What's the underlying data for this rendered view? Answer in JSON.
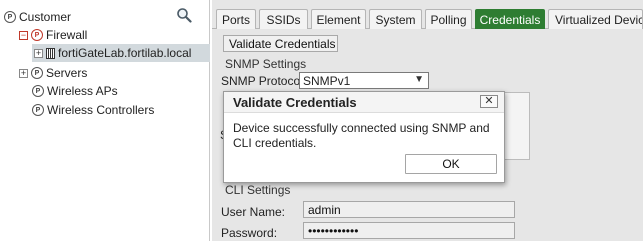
{
  "tree": {
    "search_icon": "search-icon",
    "items": [
      {
        "label": "Customer",
        "icon": "node-icon"
      },
      {
        "label": "Firewall",
        "icon": "node-icon",
        "expander": "minus"
      },
      {
        "label": "fortiGateLab.fortilab.local",
        "icon": "device-icon",
        "expander": "plus",
        "selected": true
      },
      {
        "label": "Servers",
        "icon": "node-icon",
        "expander": "plus"
      },
      {
        "label": "Wireless APs",
        "icon": "node-icon"
      },
      {
        "label": "Wireless Controllers",
        "icon": "node-icon"
      }
    ]
  },
  "tabs": [
    {
      "label": "Ports"
    },
    {
      "label": "SSIDs"
    },
    {
      "label": "Element"
    },
    {
      "label": "System"
    },
    {
      "label": "Polling"
    },
    {
      "label": "Credentials",
      "active": true
    },
    {
      "label": "Virtualized Devices"
    }
  ],
  "main": {
    "validate_button": "Validate Credentials",
    "snmp_settings": "SNMP Settings",
    "snmp_protocol_label": "SNMP Protocol:",
    "snmp_protocol_value": "SNMPv1",
    "partial_label": "S",
    "cli_settings": "CLI Settings",
    "username_label": "User Name:",
    "username_value": "admin",
    "password_label": "Password:",
    "password_value": "••••••••••••"
  },
  "dialog": {
    "title": "Validate Credentials",
    "close": "✕",
    "message": "Device successfully connected using SNMP and CLI credentials.",
    "ok": "OK"
  },
  "colors": {
    "active_tab": "#2e7d32",
    "selection": "#d2d9dd",
    "expander_red": "#c0392b"
  }
}
